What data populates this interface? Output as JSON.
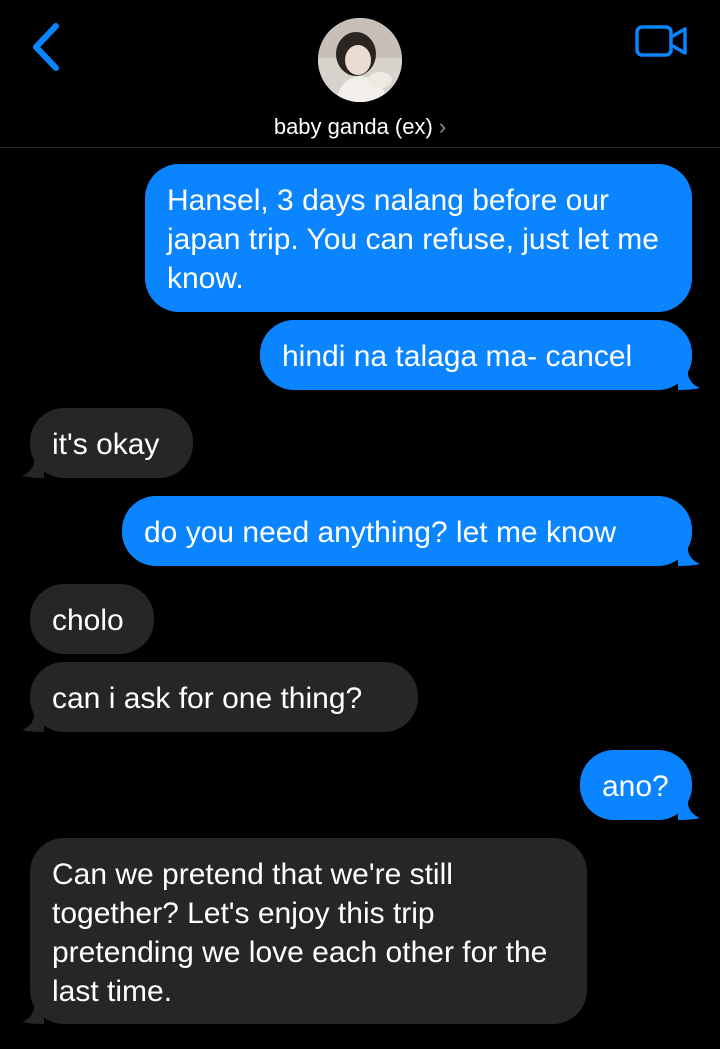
{
  "header": {
    "contact_name": "baby ganda (ex)",
    "chevron": "›",
    "back_icon": "chevron-left-icon",
    "video_icon": "video-camera-icon",
    "accent_color": "#0a84ff"
  },
  "messages": [
    {
      "from": "me",
      "text": "Hansel, 3 days nalang before our japan trip. You can refuse, just let me know."
    },
    {
      "from": "me",
      "text": "hindi na talaga ma- cancel"
    },
    {
      "from": "them",
      "text": "it's okay"
    },
    {
      "from": "me",
      "text": "do you need anything? let me know"
    },
    {
      "from": "them",
      "text": "cholo"
    },
    {
      "from": "them",
      "text": "can i ask for one thing?"
    },
    {
      "from": "me",
      "text": "ano?"
    },
    {
      "from": "them",
      "text": "Can we pretend that we're still together? Let's enjoy this trip pretending we love each other for the last time."
    }
  ],
  "colors": {
    "sent_bubble": "#0a84ff",
    "received_bubble": "#262629",
    "background": "#000000"
  }
}
